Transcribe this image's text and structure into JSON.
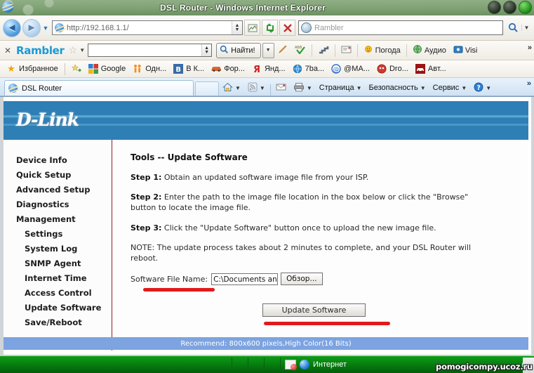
{
  "window": {
    "title": "DSL Router - Windows Internet Explorer",
    "icon": "ie-logo-icon",
    "buttons": {
      "minimize": "_",
      "maximize": "□",
      "close": "✕"
    }
  },
  "navbar": {
    "back_label": "◄",
    "forward_label": "►",
    "history_caret": "▼",
    "address_value": "http://192.168.1.1/",
    "address_spinner": "▲▼",
    "compat_label": "▨",
    "refresh_label": "↻",
    "stop_label": "✕",
    "search_placeholder": "Rambler",
    "search_go": "🔍",
    "search_caret": "▼"
  },
  "rambler_toolbar": {
    "close_label": "✕",
    "logo": "Rambler",
    "star_label": "☆",
    "caret": "▼",
    "search_value": "",
    "search_spinner": "▲▼",
    "find_label": "Найти!",
    "find_caret": "▼",
    "items": [
      {
        "label": "",
        "icon": "pencil-icon"
      },
      {
        "label": "",
        "icon": "spellcheck-abv-icon"
      },
      {
        "label": "",
        "icon": "stairs-icon"
      },
      {
        "label": "",
        "icon": "note-icon"
      },
      {
        "label": "Погода",
        "icon": "sun-weather-icon"
      },
      {
        "label": "Аудио",
        "icon": "audio-globe-icon"
      },
      {
        "label": "Visi",
        "icon": "visi-icon"
      }
    ],
    "overflow": "»"
  },
  "favorites_bar": {
    "favorites_label": "Избранное",
    "favorites_icon": "star-icon",
    "add_icon": "add-favorite-icon",
    "items": [
      {
        "label": "Google",
        "icon": "google-icon"
      },
      {
        "label": "Одн...",
        "icon": "odnoklassniki-icon"
      },
      {
        "label": "В К...",
        "icon": "vkontakte-icon"
      },
      {
        "label": "Фор...",
        "icon": "car-forum-icon"
      },
      {
        "label": "Янд...",
        "icon": "yandex-icon"
      },
      {
        "label": "7ba...",
        "icon": "globe-icon"
      },
      {
        "label": "@MA...",
        "icon": "mailru-icon"
      },
      {
        "label": "Dro...",
        "icon": "drom-icon"
      },
      {
        "label": "Авт...",
        "icon": "auto-icon"
      }
    ]
  },
  "tabbar": {
    "tab_label": "DSL Router",
    "tab_icon": "ie-page-icon",
    "new_tab_label": "",
    "commands": [
      {
        "label": "",
        "icon": "home-icon",
        "caret": "▼"
      },
      {
        "label": "",
        "icon": "rss-feed-icon",
        "caret": "▼"
      },
      {
        "label": "",
        "icon": "mail-icon",
        "caret": ""
      },
      {
        "label": "",
        "icon": "print-icon",
        "caret": "▼"
      },
      {
        "label": "Страница",
        "icon": "",
        "caret": "▼"
      },
      {
        "label": "Безопасность",
        "icon": "",
        "caret": "▼"
      },
      {
        "label": "Сервис",
        "icon": "",
        "caret": "▼"
      },
      {
        "label": "",
        "icon": "help-icon",
        "caret": "▼"
      }
    ],
    "overflow": "»"
  },
  "page": {
    "brand": "D-Link",
    "nav": [
      {
        "label": "Device Info",
        "sub": false
      },
      {
        "label": "Quick Setup",
        "sub": false
      },
      {
        "label": "Advanced Setup",
        "sub": false
      },
      {
        "label": "Diagnostics",
        "sub": false
      },
      {
        "label": "Management",
        "sub": false
      },
      {
        "label": "Settings",
        "sub": true
      },
      {
        "label": "System Log",
        "sub": true
      },
      {
        "label": "SNMP Agent",
        "sub": true
      },
      {
        "label": "Internet Time",
        "sub": true
      },
      {
        "label": "Access Control",
        "sub": true
      },
      {
        "label": "Update Software",
        "sub": true
      },
      {
        "label": "Save/Reboot",
        "sub": true
      }
    ],
    "title": "Tools -- Update Software",
    "step1_label": "Step 1:",
    "step1_text": " Obtain an updated software image file from your ISP.",
    "step2_label": "Step 2:",
    "step2_text": " Enter the path to the image file location in the box below or click the \"Browse\" button to locate the image file.",
    "step3_label": "Step 3:",
    "step3_text": " Click the \"Update Software\" button once to upload the new image file.",
    "note_text": "NOTE: The update process takes about 2 minutes to complete, and your DSL Router will reboot.",
    "file_label": "Software File Name:",
    "file_value": "C:\\Documents an",
    "browse_label": "Обзор...",
    "update_button_label": "Update Software",
    "recommend": "Recommend: 800x600 pixels,High Color(16 Bits)",
    "annotation_color": "#e01b1b"
  },
  "status_bar": {
    "zone_label": "Интернет",
    "zone_icon": "internet-zone-globe-icon",
    "blocked_icon": "blocked-content-icon",
    "zoom_icon": "zoom-globe-icon",
    "watermark": "pomogicompy.ucoz.ru"
  }
}
